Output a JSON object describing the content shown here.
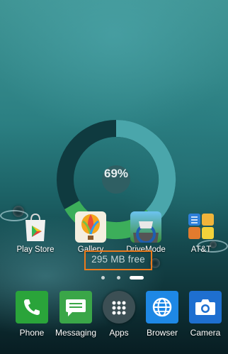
{
  "widget": {
    "storage_used_percent": "69%",
    "free_memory": "295 MB free"
  },
  "home_apps": [
    {
      "label": "Play Store"
    },
    {
      "label": "Gallery"
    },
    {
      "label": "DriveMode"
    },
    {
      "label": "AT&T"
    }
  ],
  "dock_apps": [
    {
      "label": "Phone"
    },
    {
      "label": "Messaging"
    },
    {
      "label": "Apps"
    },
    {
      "label": "Browser"
    },
    {
      "label": "Camera"
    }
  ],
  "page_indicator": {
    "pages": 3,
    "current": 3
  },
  "colors": {
    "widget_used": "#4aa6ab",
    "widget_used_green": "#3cae5a",
    "widget_track": "#0f3a3f",
    "highlight_box": "#ea7a1c",
    "phone": "#2aa43a",
    "messaging": "#3aa648",
    "browser": "#1e88e5",
    "camera": "#1e6fd0"
  }
}
